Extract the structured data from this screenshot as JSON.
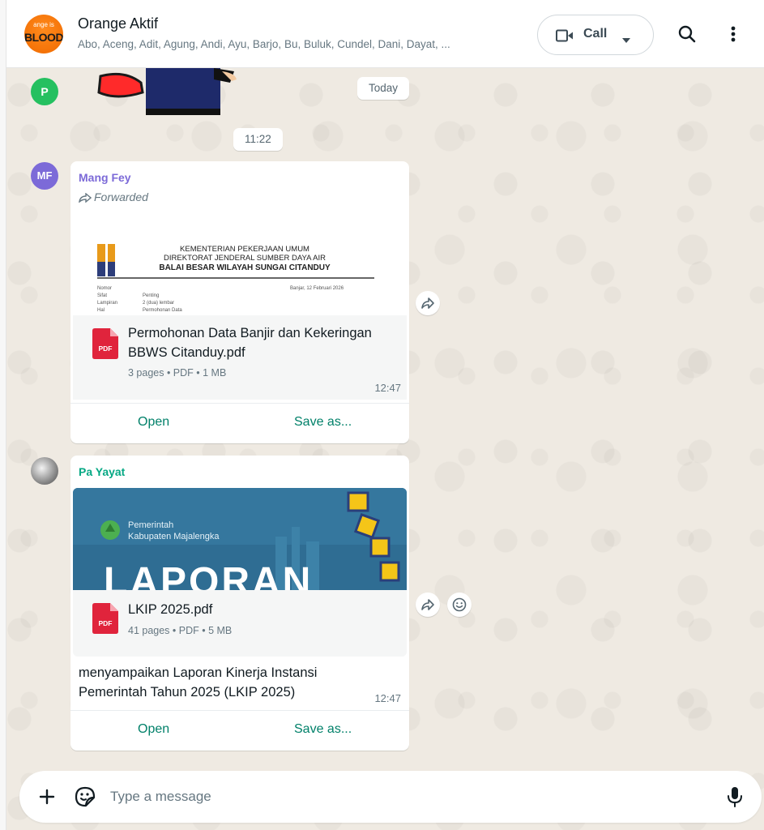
{
  "header": {
    "group_name": "Orange Aktif",
    "members": "Abo, Aceng, Adit, Agung, Andi, Ayu, Barjo, Bu, Buluk, Cundel, Dani, Dayat, ...",
    "avatar_top_text": "ange is",
    "avatar_main_text": "BLOOD",
    "call_label": "Call"
  },
  "date_chip": "Today",
  "time_chip": "11:22",
  "avatars": {
    "p": "P",
    "mf": "MF"
  },
  "messages": [
    {
      "sender": "Mang Fey",
      "forwarded": "Forwarded",
      "preview": {
        "line1": "KEMENTERIAN PEKERJAAN UMUM",
        "line2": "DIREKTORAT JENDERAL SUMBER DAYA AIR",
        "line3": "BALAI BESAR WILAYAH SUNGAI CITANDUY",
        "nomor_label": "Nomor",
        "sifat_label": "Sifat",
        "lampiran_label": "Lampiran",
        "hal_label": "Hal",
        "sifat_value": "Penting",
        "lampiran_value": "2 (dua) lembar",
        "hal_value": "Permohonan Data",
        "date_text": "Banjar, 12 Februari 2026"
      },
      "file_name": "Permohonan Data Banjir dan Kekeringan BBWS Citanduy.pdf",
      "file_meta": "3 pages • PDF • 1 MB",
      "time": "12:47",
      "open_label": "Open",
      "save_label": "Save as..."
    },
    {
      "sender": "Pa Yayat",
      "thumb": {
        "gov_line1": "Pemerintah",
        "gov_line2": "Kabupaten Majalengka",
        "title": "LAPORAN"
      },
      "file_name": "LKIP 2025.pdf",
      "file_meta": "41 pages • PDF • 5 MB",
      "caption": "menyampaikan Laporan Kinerja Instansi Pemerintah Tahun 2025 (LKIP 2025)",
      "time": "12:47",
      "open_label": "Open",
      "save_label": "Save as..."
    }
  ],
  "pdf_badge": "PDF",
  "composer": {
    "placeholder": "Type a message"
  },
  "icons": {
    "video": "video-camera-icon",
    "search": "search-icon",
    "menu": "kebab-menu-icon",
    "forward": "forward-icon",
    "emoji": "emoji-icon",
    "plus": "plus-icon",
    "sticker": "sticker-icon",
    "mic": "microphone-icon"
  },
  "colors": {
    "accent": "#008069",
    "wallpaper": "#efeae2",
    "pdf_red": "#e0243c",
    "sender_mf": "#7c6ad8",
    "sender_py": "#06a884"
  }
}
